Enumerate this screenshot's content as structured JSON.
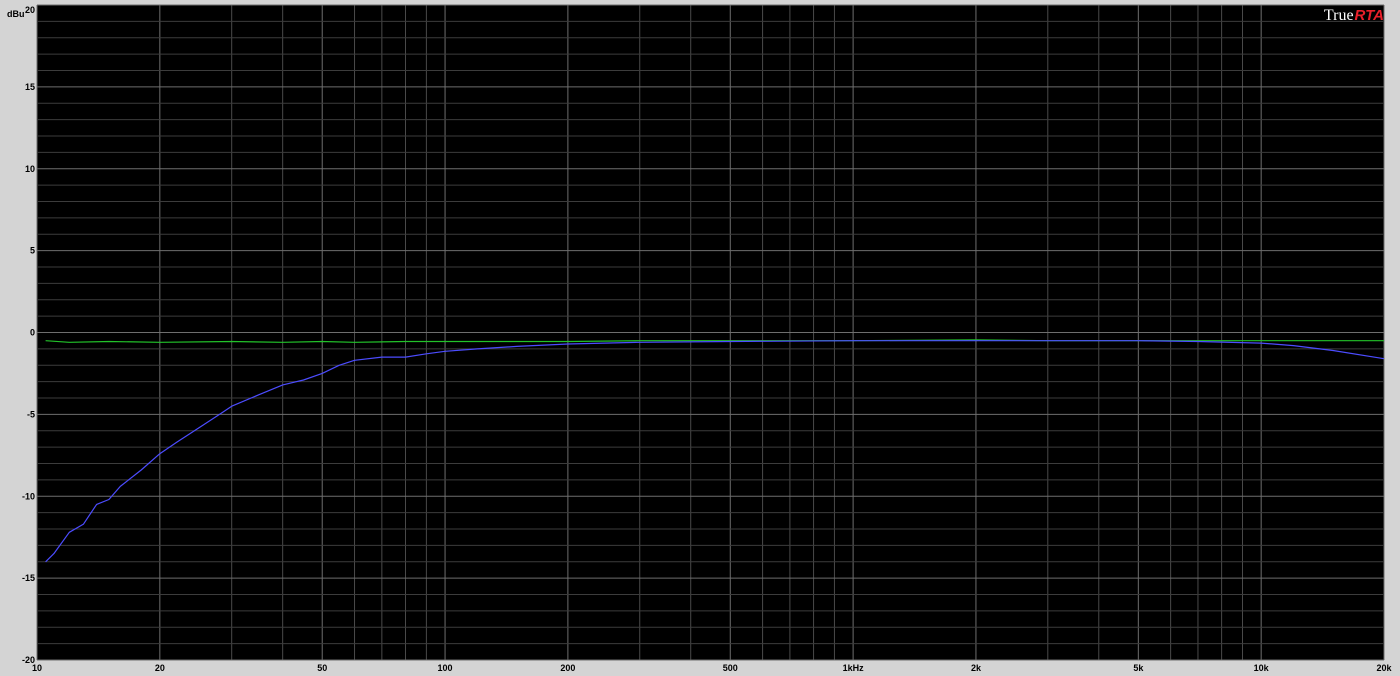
{
  "branding": {
    "part1": "True",
    "part2": "RTA",
    "part2_color": "#e8202a"
  },
  "chart_data": {
    "type": "line",
    "ylabel": "dBu",
    "x_scale": "log",
    "xlim": [
      10,
      20000
    ],
    "ylim": [
      -20,
      20
    ],
    "grid": true,
    "background": "#000000",
    "x_ticks": [
      {
        "value": 10,
        "label": "10"
      },
      {
        "value": 20,
        "label": "20"
      },
      {
        "value": 50,
        "label": "50"
      },
      {
        "value": 100,
        "label": "100"
      },
      {
        "value": 200,
        "label": "200"
      },
      {
        "value": 500,
        "label": "500"
      },
      {
        "value": 1000,
        "label": "1kHz"
      },
      {
        "value": 2000,
        "label": "2k"
      },
      {
        "value": 5000,
        "label": "5k"
      },
      {
        "value": 10000,
        "label": "10k"
      },
      {
        "value": 20000,
        "label": "20k"
      }
    ],
    "y_ticks": [
      {
        "value": 20,
        "label": "20"
      },
      {
        "value": 15,
        "label": "15"
      },
      {
        "value": 10,
        "label": "10"
      },
      {
        "value": 5,
        "label": "5"
      },
      {
        "value": 0,
        "label": "0"
      },
      {
        "value": -5,
        "label": "-5"
      },
      {
        "value": -10,
        "label": "-10"
      },
      {
        "value": -15,
        "label": "-15"
      },
      {
        "value": -20,
        "label": "-20"
      }
    ],
    "series": [
      {
        "color": "#22c22a",
        "x": [
          10.5,
          12,
          15,
          20,
          30,
          40,
          50,
          60,
          80,
          100,
          150,
          200,
          300,
          500,
          700,
          1000,
          2000,
          3000,
          5000,
          7000,
          10000,
          15000,
          20000
        ],
        "y": [
          -0.5,
          -0.6,
          -0.55,
          -0.6,
          -0.55,
          -0.6,
          -0.55,
          -0.6,
          -0.55,
          -0.55,
          -0.55,
          -0.55,
          -0.5,
          -0.5,
          -0.5,
          -0.5,
          -0.45,
          -0.5,
          -0.5,
          -0.5,
          -0.5,
          -0.5,
          -0.5
        ]
      },
      {
        "color": "#4c4cff",
        "x": [
          10.5,
          11,
          12,
          13,
          14,
          15,
          16,
          18,
          20,
          22,
          25,
          28,
          30,
          35,
          40,
          45,
          50,
          55,
          60,
          70,
          80,
          90,
          100,
          120,
          150,
          200,
          300,
          500,
          1000,
          2000,
          5000,
          7000,
          10000,
          12000,
          15000,
          20000
        ],
        "y": [
          -14,
          -13.5,
          -12.2,
          -11.7,
          -10.5,
          -10.2,
          -9.4,
          -8.4,
          -7.4,
          -6.7,
          -5.8,
          -5.0,
          -4.5,
          -3.8,
          -3.2,
          -2.9,
          -2.5,
          -2.0,
          -1.7,
          -1.5,
          -1.5,
          -1.3,
          -1.15,
          -1.0,
          -0.85,
          -0.7,
          -0.6,
          -0.55,
          -0.5,
          -0.5,
          -0.5,
          -0.55,
          -0.65,
          -0.8,
          -1.1,
          -1.6
        ]
      }
    ]
  }
}
